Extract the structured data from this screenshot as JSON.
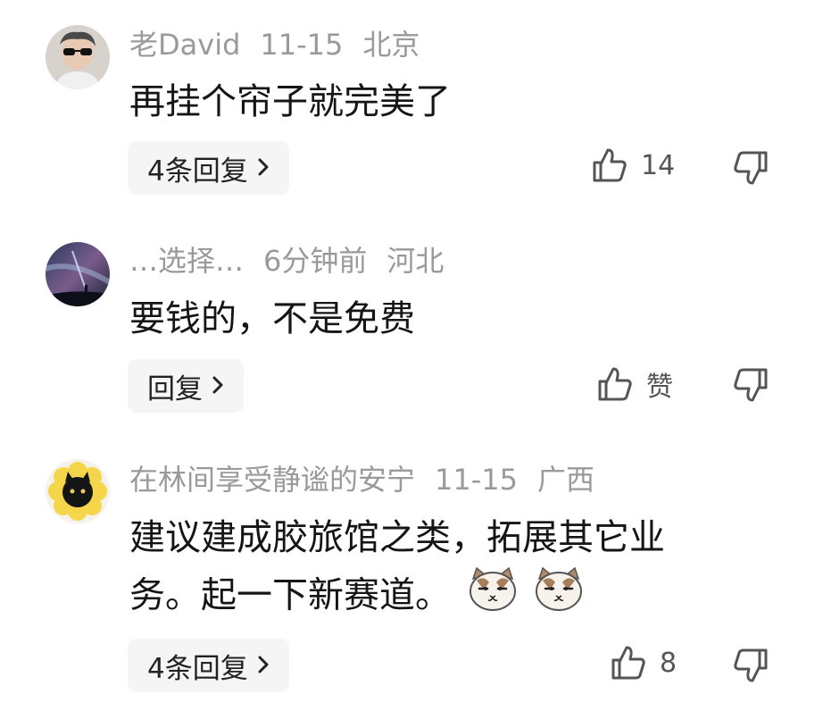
{
  "comments": [
    {
      "user": "老David",
      "time": "11-15",
      "location": "北京",
      "text": "再挂个帘子就完美了",
      "reply_label": "4条回复",
      "like_count": "14",
      "avatar_icon": "person-with-sunglasses-avatar"
    },
    {
      "user": "…选择…",
      "time": "6分钟前",
      "location": "河北",
      "text": "要钱的，不是免费",
      "reply_label": "回复",
      "like_count": "赞",
      "avatar_icon": "night-sky-avatar"
    },
    {
      "user": "在林间享受静谧的安宁",
      "time": "11-15",
      "location": "广西",
      "text_line1": "建议建成胶旅馆之类，拓展其它业",
      "text_line2": "务。起一下新赛道。",
      "reply_label": "4条回复",
      "like_count": "8",
      "avatar_icon": "black-cat-flower-avatar",
      "emojis": [
        "cat-face-emoji",
        "cat-face-emoji"
      ]
    }
  ],
  "icons": {
    "reply_chevron": "chevron-right-icon",
    "like": "thumbs-up-icon",
    "dislike": "thumbs-down-icon"
  },
  "colors": {
    "meta_text": "#9a9a9a",
    "reply_bg": "#f5f5f5"
  }
}
